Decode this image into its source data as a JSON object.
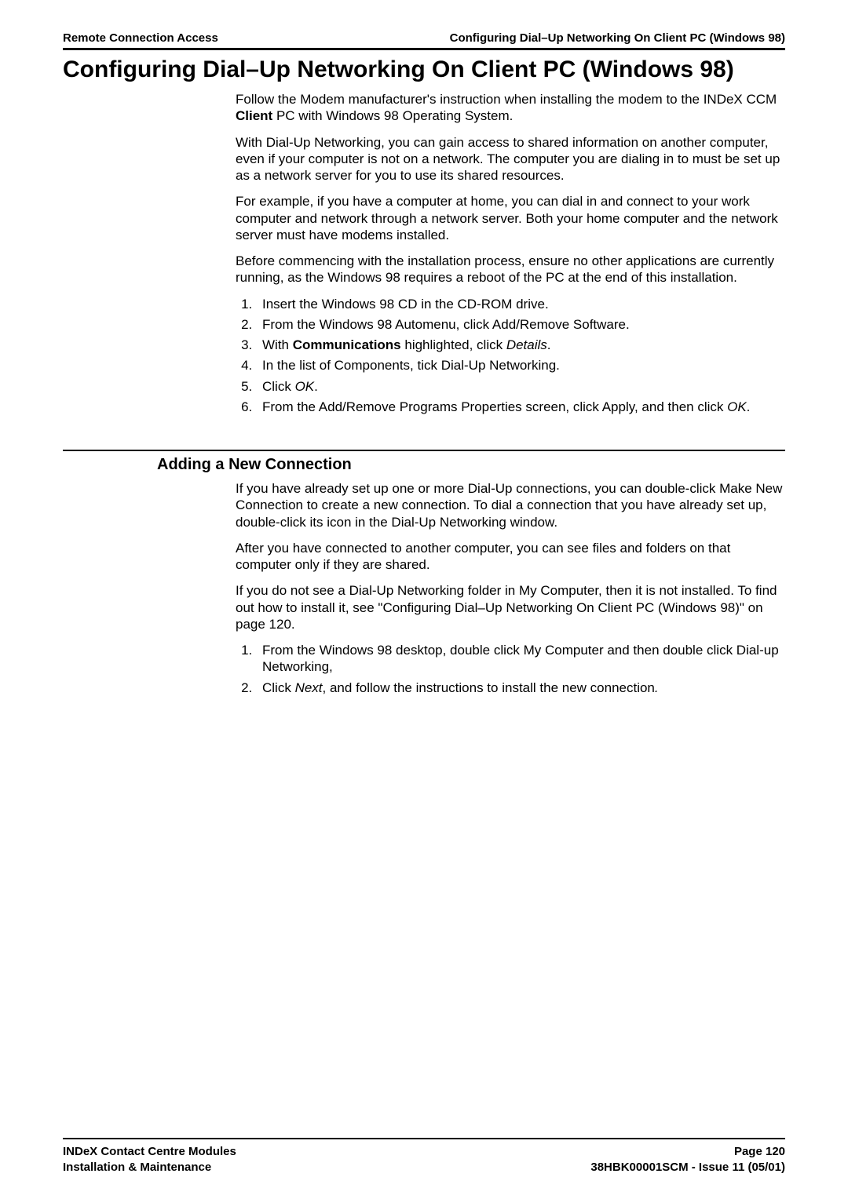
{
  "header": {
    "left": "Remote Connection Access",
    "right": "Configuring Dial–Up Networking On Client PC (Windows 98)"
  },
  "page_title": "Configuring Dial–Up Networking On Client PC (Windows 98)",
  "intro": {
    "p1_pre": "Follow the Modem manufacturer's instruction when installing the modem to the INDeX CCM ",
    "p1_bold": "Client",
    "p1_post": " PC with Windows 98 Operating System.",
    "p2": "With Dial-Up Networking, you can gain access to shared information on another computer, even if your computer is not on a network.  The computer you are dialing in to must be set up as a network server for you to use its shared resources.",
    "p3": "For example, if you have a computer at home, you can dial in and connect to your work computer and network through a network server.  Both your home computer and the network server must have modems installed.",
    "p4": "Before commencing with the installation process, ensure no other applications are currently running, as the Windows 98 requires a reboot of the PC at the end of this installation."
  },
  "steps1": {
    "s1": "Insert the Windows 98 CD in the CD-ROM drive.",
    "s2": "From the Windows 98 Automenu, click Add/Remove Software.",
    "s3_pre": "With ",
    "s3_bold": "Communications",
    "s3_mid": " highlighted, click ",
    "s3_ital": "Details",
    "s3_post": ".",
    "s4": "In the list of Components, tick Dial-Up Networking.",
    "s5_pre": "Click ",
    "s5_ital": "OK",
    "s5_post": ".",
    "s6_pre": "From the Add/Remove Programs Properties screen, click Apply, and then click ",
    "s6_ital": "OK",
    "s6_post": "."
  },
  "section2_title": "Adding a New Connection",
  "section2": {
    "p1": "If you have already set up one or more Dial-Up connections, you can double-click Make New Connection to create a new connection.  To dial a connection that you have already set up, double-click its icon in the Dial-Up Networking window.",
    "p2": "After you have connected to another computer, you can see files and folders on that computer only if they are shared.",
    "p3": "If you do not see a Dial-Up Networking folder in My Computer, then it is not installed.  To find out how to install it, see \"Configuring Dial–Up Networking On Client PC (Windows 98)\" on page 120."
  },
  "steps2": {
    "s1": "From the Windows 98 desktop, double click My Computer and then double click Dial-up Networking,",
    "s2_pre": "Click ",
    "s2_ital": "Next",
    "s2_mid": ", and follow the instructions to install the new connection",
    "s2_post_ital": "."
  },
  "footer": {
    "left1": "INDeX Contact Centre Modules",
    "left2": "Installation & Maintenance",
    "right1": "Page 120",
    "right2": "38HBK00001SCM - Issue 11 (05/01)"
  }
}
